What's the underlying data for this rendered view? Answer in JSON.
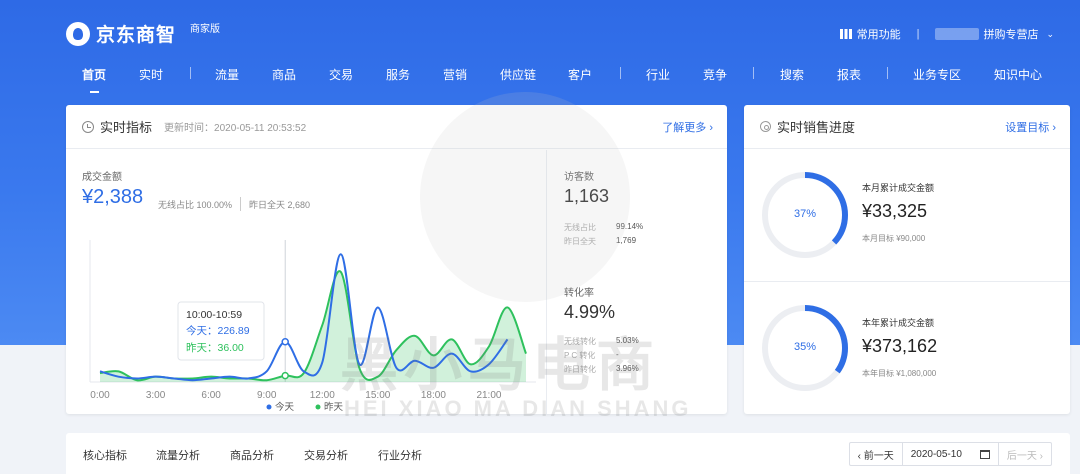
{
  "app": {
    "logo": "京东商智",
    "edition": "商家版"
  },
  "topbar": {
    "common_label": "常用功能",
    "shop_label": "拼购专营店"
  },
  "nav": [
    {
      "label": "首页",
      "active": true
    },
    {
      "label": "实时"
    },
    {
      "label": "流量"
    },
    {
      "label": "商品"
    },
    {
      "label": "交易"
    },
    {
      "label": "服务"
    },
    {
      "label": "营销"
    },
    {
      "label": "供应链"
    },
    {
      "label": "客户"
    },
    {
      "label": "行业"
    },
    {
      "label": "竞争"
    },
    {
      "label": "搜索"
    },
    {
      "label": "报表"
    },
    {
      "label": "业务专区"
    },
    {
      "label": "知识中心"
    }
  ],
  "realtime": {
    "title": "实时指标",
    "update_time": "更新时间：2020-05-11 20:53:52",
    "more_link": "了解更多 ›",
    "gmv_label": "成交金额",
    "gmv_value": "¥2,388",
    "gmv_wireless": "无线占比  100.00%",
    "gmv_yesterday": "昨日全天  2,680",
    "visitors_label": "访客数",
    "visitors_value": "1,163",
    "visitors_wireless_label": "无线占比",
    "visitors_wireless_value": "99.14%",
    "visitors_yesterday_label": "昨日全天",
    "visitors_yesterday_value": "1,769",
    "conv_label": "转化率",
    "conv_value": "4.99%",
    "conv_wireless_label": "无线转化",
    "conv_wireless_value": "5.03%",
    "conv_pc_label": "P C 转化",
    "conv_pc_value": "-",
    "conv_yesterday_label": "昨日转化",
    "conv_yesterday_value": "3.96%"
  },
  "chart_data": {
    "type": "area",
    "x_ticks": [
      "0:00",
      "3:00",
      "6:00",
      "9:00",
      "12:00",
      "15:00",
      "18:00",
      "21:00"
    ],
    "x": [
      0,
      1,
      2,
      3,
      4,
      5,
      6,
      7,
      8,
      9,
      10,
      11,
      12,
      13,
      14,
      15,
      16,
      17,
      18,
      19,
      20,
      21,
      22,
      23
    ],
    "series": [
      {
        "name": "今天",
        "color": "#2f6ee5",
        "values": [
          60,
          30,
          20,
          30,
          20,
          10,
          20,
          30,
          20,
          60,
          226.89,
          60,
          110,
          720,
          100,
          420,
          80,
          120,
          80,
          160,
          60,
          100,
          240
        ]
      },
      {
        "name": "昨天",
        "color": "#2ec15d",
        "values": [
          50,
          60,
          10,
          30,
          20,
          20,
          30,
          20,
          20,
          10,
          36.0,
          50,
          320,
          620,
          80,
          30,
          180,
          260,
          150,
          240,
          100,
          200,
          420,
          160
        ]
      }
    ],
    "ylim": [
      0,
      800
    ],
    "grid": false,
    "legend": "bottom",
    "tooltip": {
      "time": "10:00-10:59",
      "today": "今天：226.89",
      "yesterday": "昨天：36.00"
    }
  },
  "legend": {
    "today": "今天",
    "yesterday": "昨天"
  },
  "sales": {
    "title": "实时销售进度",
    "link": "设置目标 ›",
    "month": {
      "label": "本月累计成交金额",
      "value": "¥33,325",
      "target": "本月目标  ¥90,000",
      "pct_text": "37%",
      "pct": 0.37
    },
    "year": {
      "label": "本年累计成交金额",
      "value": "¥373,162",
      "target": "本年目标  ¥1,080,000",
      "pct_text": "35%",
      "pct": 0.35
    }
  },
  "tabs": [
    "核心指标",
    "流量分析",
    "商品分析",
    "交易分析",
    "行业分析"
  ],
  "date_picker": {
    "prev": "‹ 前一天",
    "date": "2020-05-10",
    "next": "后一天 ›"
  },
  "watermark": {
    "cn": "黑小马电商",
    "en": "HEI XIAO MA DIAN SHANG"
  }
}
